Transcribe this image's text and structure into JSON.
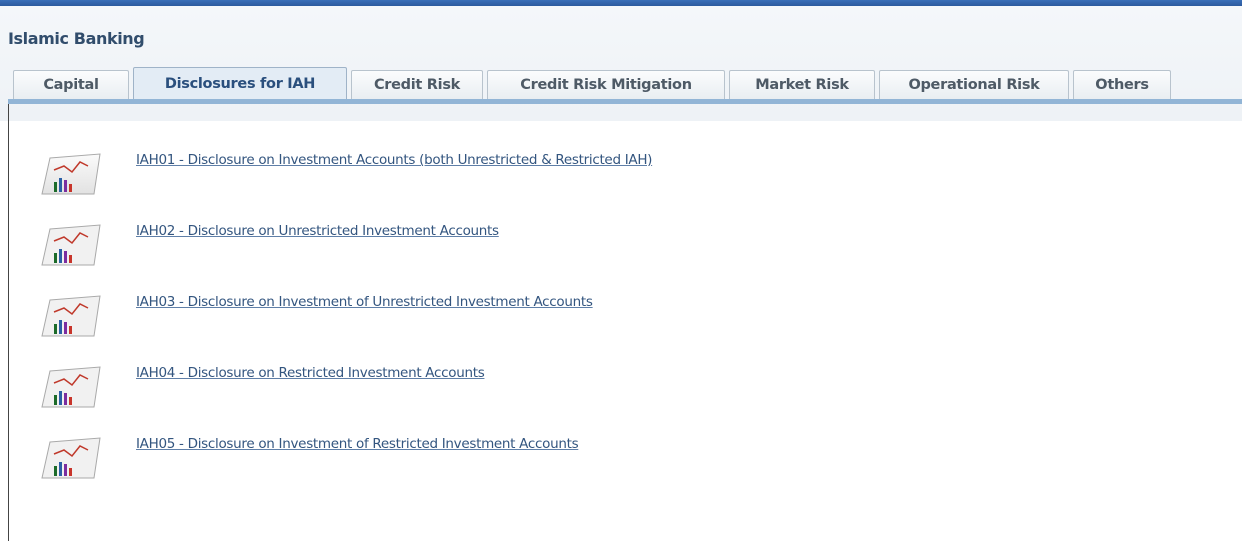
{
  "header": {
    "title": "Islamic Banking"
  },
  "tabs": [
    {
      "label": "Capital",
      "active": false
    },
    {
      "label": "Disclosures for IAH",
      "active": true
    },
    {
      "label": "Credit Risk",
      "active": false
    },
    {
      "label": "Credit Risk Mitigation",
      "active": false
    },
    {
      "label": "Market Risk",
      "active": false
    },
    {
      "label": "Operational Risk",
      "active": false
    },
    {
      "label": "Others",
      "active": false
    }
  ],
  "reports": [
    {
      "label": "IAH01 - Disclosure on Investment Accounts (both Unrestricted & Restricted IAH)",
      "icon": "report-chart-icon"
    },
    {
      "label": "IAH02 - Disclosure on Unrestricted Investment Accounts",
      "icon": "report-chart-icon"
    },
    {
      "label": "IAH03 - Disclosure on Investment of Unrestricted Investment Accounts",
      "icon": "report-chart-icon"
    },
    {
      "label": "IAH04 - Disclosure on Restricted Investment Accounts",
      "icon": "report-chart-icon"
    },
    {
      "label": "IAH05 - Disclosure on Investment of Restricted Investment Accounts",
      "icon": "report-chart-icon"
    }
  ],
  "colors": {
    "accent": "#2c5a9e",
    "tab_rule": "#92b5d6",
    "link": "#33557f",
    "title": "#314d6c"
  }
}
